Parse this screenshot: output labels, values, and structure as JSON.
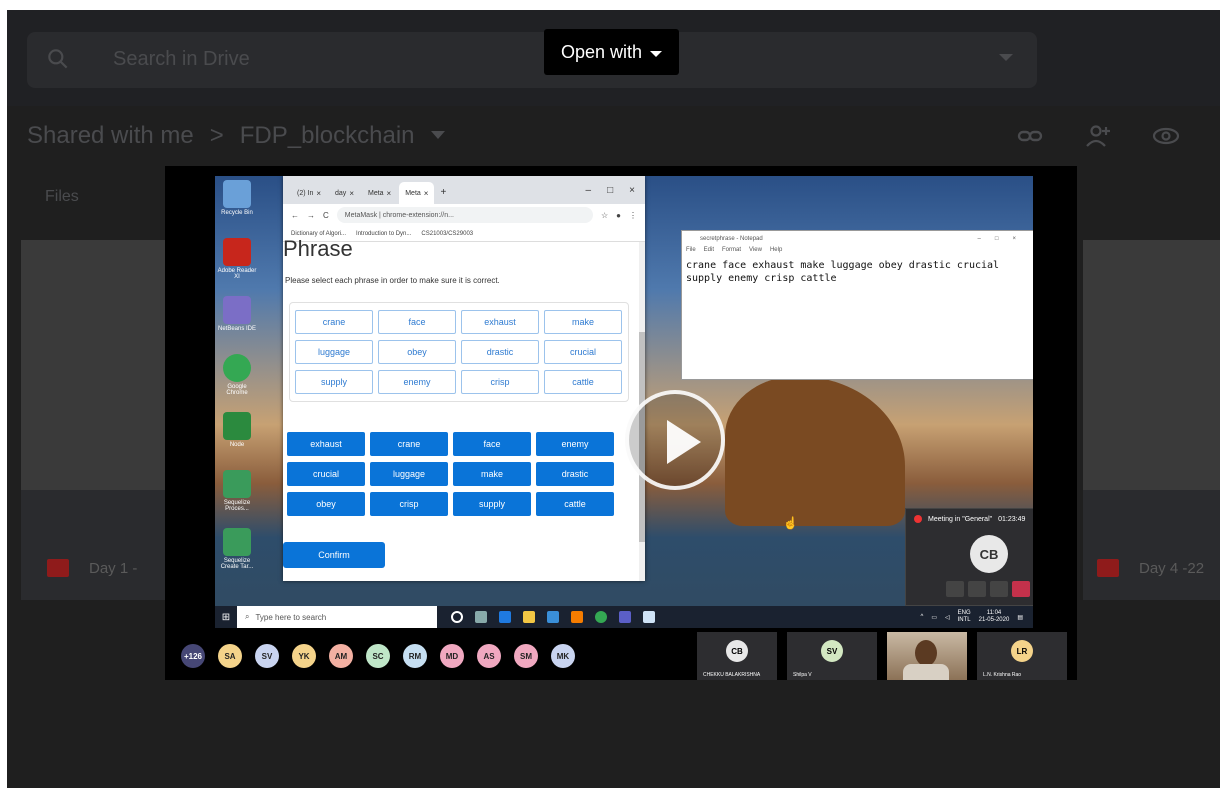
{
  "drive": {
    "search_placeholder": "Search in Drive",
    "open_with": "Open with",
    "breadcrumb": {
      "parent": "Shared with me",
      "separator": ">",
      "current": "FDP_blockchain"
    },
    "files_label": "Files",
    "files": [
      {
        "name": "Day 1 -"
      },
      {
        "name": "Day 4 -22"
      }
    ]
  },
  "browser": {
    "tabs": [
      {
        "label": "(2) In"
      },
      {
        "label": "day"
      },
      {
        "label": "Meta"
      },
      {
        "label": "Meta"
      }
    ],
    "new_tab": "+",
    "address": "MetaMask | chrome-extension://n...",
    "bookmarks": [
      "Dictionary of Algori...",
      "Introduction to Dyn...",
      "CS21003/CS29003"
    ]
  },
  "metamask": {
    "heading": "Phrase",
    "instruction": "Please select each phrase in order to make sure it is correct.",
    "selected_words": [
      "crane",
      "face",
      "exhaust",
      "make",
      "luggage",
      "obey",
      "drastic",
      "crucial",
      "supply",
      "enemy",
      "crisp",
      "cattle"
    ],
    "shuffled_words": [
      "exhaust",
      "crane",
      "face",
      "enemy",
      "crucial",
      "luggage",
      "make",
      "drastic",
      "obey",
      "crisp",
      "supply",
      "cattle"
    ],
    "confirm_label": "Confirm"
  },
  "notepad": {
    "title": "secretphrase - Notepad",
    "menu": [
      "File",
      "Edit",
      "Format",
      "View",
      "Help"
    ],
    "text": "crane face exhaust make luggage obey drastic crucial\nsupply enemy crisp cattle"
  },
  "meeting": {
    "title": "Meeting in \"General\"",
    "elapsed": "01:23:49",
    "initials": "CB"
  },
  "taskbar": {
    "search_placeholder": "Type here to search",
    "lang": "ENG",
    "layout": "INTL",
    "time": "11:04",
    "date": "21-05-2020"
  },
  "desktop_icons": [
    {
      "label": "Recycle Bin",
      "color": "#6aa0d8"
    },
    {
      "label": "Adobe Reader XI",
      "color": "#c7261c"
    },
    {
      "label": "NetBeans IDE",
      "color": "#7b6ec6"
    },
    {
      "label": "Google Chrome",
      "color": "#34a853"
    },
    {
      "label": "Node",
      "color": "#2b8a3e"
    },
    {
      "label": "Sequelize Proces...",
      "color": "#3a9b5b"
    },
    {
      "label": "Sequelize Create Tar...",
      "color": "#3a9b5b"
    }
  ],
  "participants": {
    "overflow": "+126",
    "avatars": [
      {
        "initials": "SA",
        "color": "#f4d38a"
      },
      {
        "initials": "SV",
        "color": "#c9d4f0"
      },
      {
        "initials": "YK",
        "color": "#f4d38a"
      },
      {
        "initials": "AM",
        "color": "#f3b0a2"
      },
      {
        "initials": "SC",
        "color": "#bfe6c8"
      },
      {
        "initials": "RM",
        "color": "#c6dff2"
      },
      {
        "initials": "MD",
        "color": "#f0a8c0"
      },
      {
        "initials": "AS",
        "color": "#f0a8c0"
      },
      {
        "initials": "SM",
        "color": "#f0a8c0"
      },
      {
        "initials": "MK",
        "color": "#c9d4f0"
      }
    ],
    "videos": [
      {
        "initials": "CB",
        "name": "CHEKKU BALAKRISHNA",
        "color": "#e8e8e8"
      },
      {
        "initials": "SV",
        "name": "Shilpa V",
        "color": "#d3e8c2"
      },
      {
        "initials": "LR",
        "name": "L.N. Krishna Rao",
        "color": "#f4d38a"
      }
    ]
  }
}
